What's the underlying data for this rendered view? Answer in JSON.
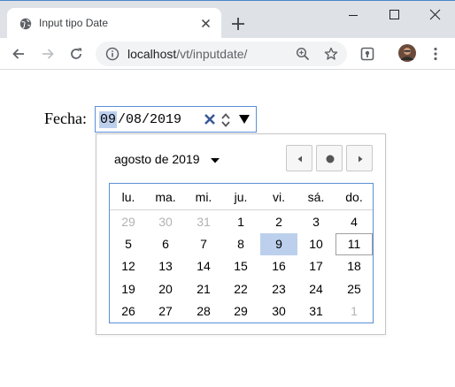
{
  "browser": {
    "tab_title": "Input tipo Date",
    "url_host": "localhost",
    "url_path": "/vt/inputdate/",
    "icons": [
      "globe-icon",
      "close-icon",
      "plus-icon",
      "minimize-icon",
      "maximize-icon",
      "close-window-icon",
      "back-arrow-icon",
      "forward-arrow-icon",
      "reload-icon",
      "info-icon",
      "zoom-icon",
      "star-icon",
      "extension-icon",
      "profile-avatar",
      "kebab-menu-icon"
    ]
  },
  "form": {
    "label": "Fecha:",
    "day": "09",
    "month": "08",
    "year": "2019",
    "separator": "/"
  },
  "calendar": {
    "month_label": "agosto de 2019",
    "weekdays": [
      "lu.",
      "ma.",
      "mi.",
      "ju.",
      "vi.",
      "sá.",
      "do."
    ],
    "weeks": [
      [
        "29",
        "30",
        "31",
        "1",
        "2",
        "3",
        "4"
      ],
      [
        "5",
        "6",
        "7",
        "8",
        "9",
        "10",
        "11"
      ],
      [
        "12",
        "13",
        "14",
        "15",
        "16",
        "17",
        "18"
      ],
      [
        "19",
        "20",
        "21",
        "22",
        "23",
        "24",
        "25"
      ],
      [
        "26",
        "27",
        "28",
        "29",
        "30",
        "31",
        "1"
      ]
    ],
    "other_month_cells": [
      "0-0",
      "0-1",
      "0-2",
      "4-6"
    ],
    "selected_cell": "1-4",
    "today_cell": "1-6",
    "colors": {
      "selection": "#bcd0ed",
      "focus_border": "#5b8fd6",
      "muted": "#b2b2b2"
    }
  }
}
